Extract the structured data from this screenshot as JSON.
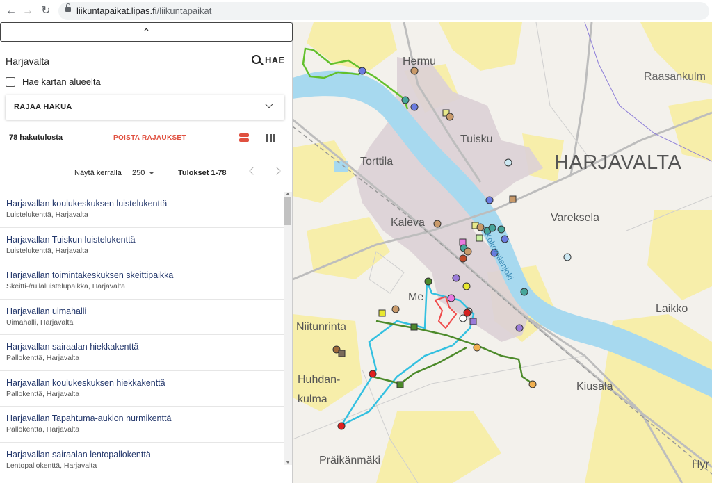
{
  "browser": {
    "url_host": "liikuntapaikat.lipas.fi",
    "url_path": "/liikuntapaikat"
  },
  "panel": {
    "collapse_glyph": "⌃",
    "search": {
      "value": "Harjavalta"
    },
    "search_button": "HAE",
    "map_area_checkbox": "Hae kartan alueelta",
    "filter": "RAJAA HAKUA",
    "result_count": "78 hakutulosta",
    "clear_filters": "POISTA RAJAUKSET",
    "pager": {
      "show_label": "Näytä kerralla",
      "page_size": "250",
      "results_range": "Tulokset 1-78"
    },
    "results": [
      {
        "name": "Harjavallan koulukeskuksen luistelukenttä",
        "type": "Luistelukenttä, Harjavalta"
      },
      {
        "name": "Harjavallan Tuiskun luistelukenttä",
        "type": "Luistelukenttä, Harjavalta"
      },
      {
        "name": "Harjavallan toimintakeskuksen skeittipaikka",
        "type": "Skeitti-/rullaluistelupaikka, Harjavalta"
      },
      {
        "name": "Harjavallan uimahalli",
        "type": "Uimahalli, Harjavalta"
      },
      {
        "name": "Harjavallan sairaalan hiekkakenttä",
        "type": "Pallokenttä, Harjavalta"
      },
      {
        "name": "Harjavallan koulukeskuksen hiekkakenttä",
        "type": "Pallokenttä, Harjavalta"
      },
      {
        "name": "Harjavallan Tapahtuma-aukion nurmikenttä",
        "type": "Pallokenttä, Harjavalta"
      },
      {
        "name": "Harjavallan sairaalan lentopallokenttä",
        "type": "Lentopallokenttä, Harjavalta"
      }
    ]
  },
  "map": {
    "place_names": {
      "hermu": "Hermu",
      "raasankulma": "Raasankulm",
      "tuisku": "Tuisku",
      "torttila": "Torttila",
      "harjavalta": "HARJAVALTA",
      "kaleva": "Kaleva",
      "vareksela": "Vareksela",
      "river": "Kokemäenjoki",
      "merstola": "Me",
      "laikko": "Laikko",
      "niitunrinta": "Niitunrinta",
      "huhdan": "Huhdan-",
      "kulma": "kulma",
      "kiusala": "Kiusala",
      "praikanmaki": "Präikänmäki",
      "hyr": "Hyr"
    }
  }
}
